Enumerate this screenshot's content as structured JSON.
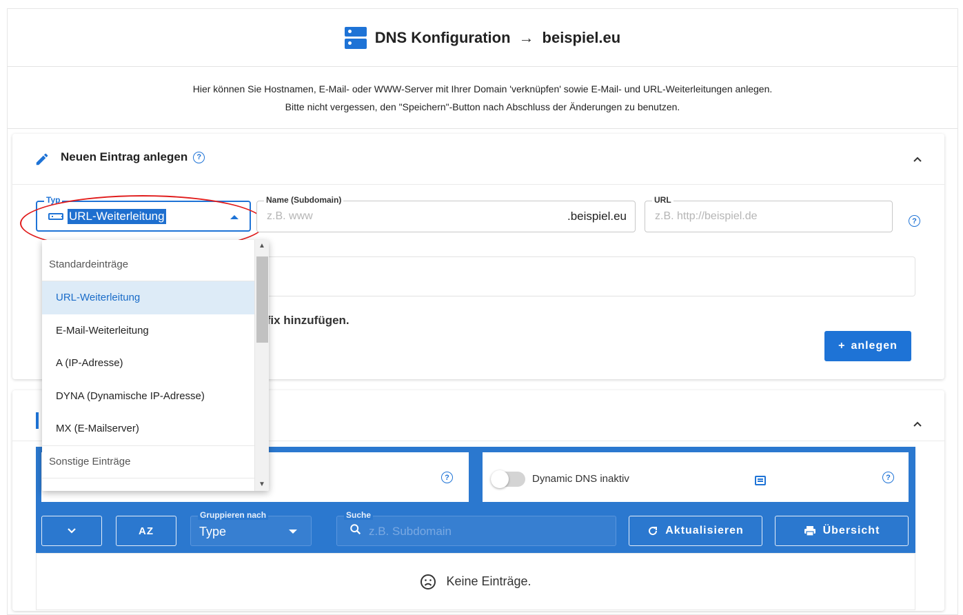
{
  "header": {
    "title": "DNS Konfiguration",
    "arrow": "→",
    "domain": "beispiel.eu"
  },
  "intro": {
    "line1": "Hier können Sie Hostnamen, E-Mail- oder WWW-Server mit Ihrer Domain 'verknüpfen' sowie E-Mail- und URL-Weiterleitungen anlegen.",
    "line2": "Bitte nicht vergessen, den \"Speichern\"-Button nach Abschluss der Änderungen zu benutzen."
  },
  "new_entry": {
    "title": "Neuen Eintrag anlegen",
    "help": "?",
    "typ_label": "Typ",
    "typ_value": "URL-Weiterleitung",
    "name_label": "Name (Subdomain)",
    "name_placeholder": "z.B. www",
    "name_suffix": ".beispiel.eu",
    "url_label": "URL",
    "url_placeholder": "z.B. http://beispiel.de",
    "hint_partial": "ifix hinzufügen.",
    "add_button": "anlegen",
    "add_button_icon": "+"
  },
  "dropdown": {
    "groups": [
      {
        "label": "Standardeinträge",
        "items": [
          {
            "label": "URL-Weiterleitung",
            "selected": true
          },
          {
            "label": "E-Mail-Weiterleitung",
            "selected": false
          },
          {
            "label": "A (IP-Adresse)",
            "selected": false
          },
          {
            "label": "DYNA (Dynamische IP-Adresse)",
            "selected": false
          },
          {
            "label": "MX (E-Mailserver)",
            "selected": false
          }
        ]
      },
      {
        "label": "Sonstige Einträge",
        "items": []
      }
    ]
  },
  "entries": {
    "dyndns_label": "Dynamic DNS inaktiv",
    "help": "?",
    "group_label": "Gruppieren nach",
    "group_value": "Type",
    "search_label": "Suche",
    "search_placeholder": "z.B. Subdomain",
    "sort_label": "AZ",
    "refresh_button": "Aktualisieren",
    "overview_button": "Übersicht",
    "empty_text": "Keine Einträge."
  },
  "colors": {
    "accent": "#1e73d6",
    "panel": "#2b78cf",
    "highlight_ellipse": "#e01b1b",
    "selected_item_bg": "#ddebf7"
  }
}
